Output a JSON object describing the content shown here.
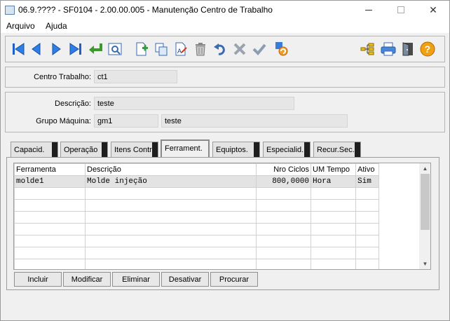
{
  "window": {
    "title": "06.9.???? - SF0104 - 2.00.00.005 - Manutenção Centro de Trabalho"
  },
  "menu": {
    "items": [
      "Arquivo",
      "Ajuda"
    ]
  },
  "toolbar": {
    "icons": [
      "first-record-icon",
      "previous-record-icon",
      "next-record-icon",
      "last-record-icon",
      "go-to-icon",
      "search-record-icon",
      "new-icon",
      "copy-icon",
      "edit-icon",
      "delete-icon",
      "undo-icon",
      "cancel-icon",
      "confirm-icon",
      "refresh-icon",
      "hierarchy-icon",
      "print-icon",
      "exit-icon",
      "help-icon"
    ]
  },
  "header": {
    "centro_label": "Centro Trabalho:",
    "centro_value": "ct1"
  },
  "details": {
    "descricao_label": "Descrição:",
    "descricao_value": "teste",
    "grupo_label": "Grupo Máquina:",
    "grupo_code": "gm1",
    "grupo_desc": "teste"
  },
  "tabs": [
    "Capacid.",
    "Operação",
    "Itens Contr",
    "Ferrament.",
    "Equiptos.",
    "Especialid.",
    "Recur.Sec."
  ],
  "active_tab": "Ferrament.",
  "grid": {
    "columns": [
      "Ferramenta",
      "Descrição",
      "Nro Ciclos",
      "UM Tempo",
      "Ativo"
    ],
    "rows": [
      [
        "molde1",
        "Molde injeção",
        "800,0000",
        "Hora",
        "Sim"
      ]
    ]
  },
  "buttons": {
    "incluir": "Incluir",
    "modificar": "Modificar",
    "eliminar": "Eliminar",
    "desativar": "Desativar",
    "procurar": "Procurar"
  }
}
